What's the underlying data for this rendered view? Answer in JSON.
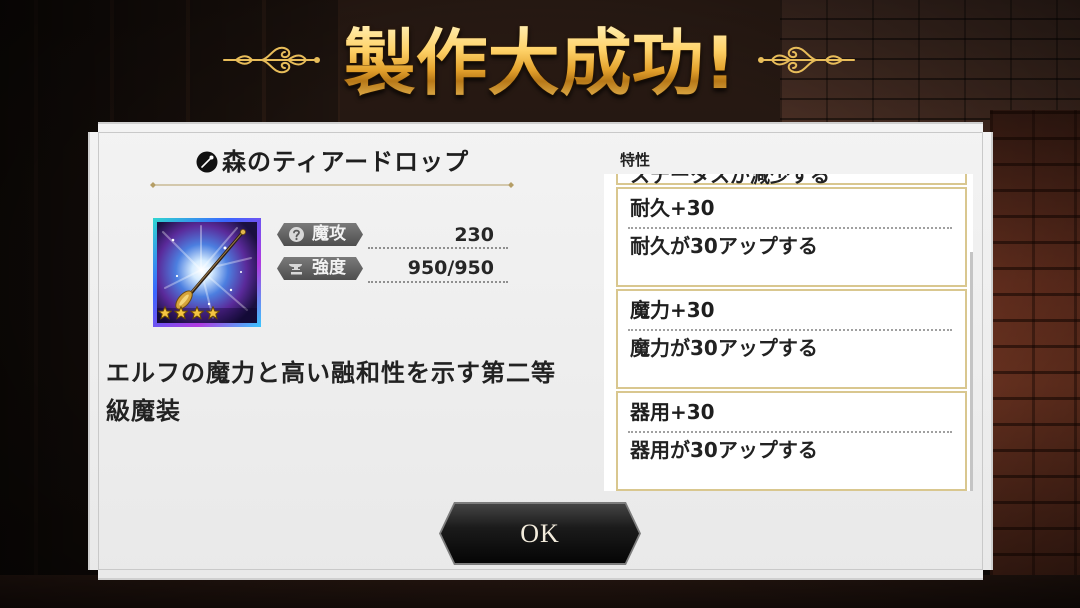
{
  "title": "製作大成功!",
  "item": {
    "name_icon": "wand-icon",
    "name": "森のティアードロップ",
    "image_icon": "magic-wand-image",
    "rarity_stars": 4,
    "stats": [
      {
        "icon": "magic-attack-icon",
        "label": "魔攻",
        "value": "230"
      },
      {
        "icon": "anvil-icon",
        "label": "強度",
        "value": "950/950"
      }
    ],
    "description": "エルフの魔力と高い融和性を示す第二等級魔装"
  },
  "traits": {
    "label": "特性",
    "partial_item_desc": "ステータスが減少する",
    "items": [
      {
        "title": "耐久+30",
        "desc": "耐久が30アップする"
      },
      {
        "title": "魔力+30",
        "desc": "魔力が30アップする"
      },
      {
        "title": "器用+30",
        "desc": "器用が30アップする"
      }
    ]
  },
  "ok_button": {
    "label": "OK"
  },
  "colors": {
    "title_gold": "#ffd36a",
    "panel": "#ececec",
    "trait_border": "#d9c78f",
    "button": "#111111",
    "star": "#f5c542"
  }
}
